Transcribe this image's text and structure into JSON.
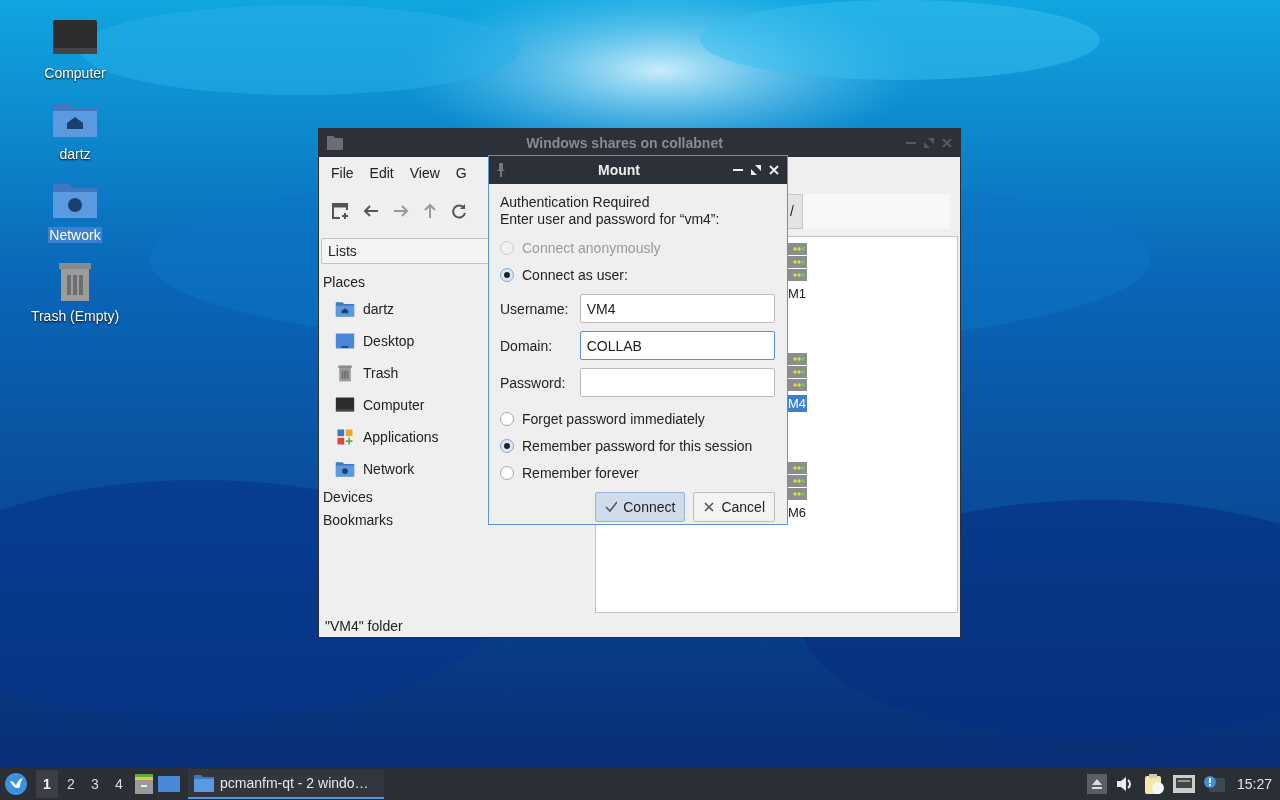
{
  "desktop_icons": [
    {
      "label": "Computer",
      "kind": "monitor",
      "selected": false
    },
    {
      "label": "dartz",
      "kind": "home-folder",
      "selected": false
    },
    {
      "label": "Network",
      "kind": "network-folder",
      "selected": true
    },
    {
      "label": "Trash (Empty)",
      "kind": "trash",
      "selected": false
    }
  ],
  "file_manager": {
    "title": "Windows shares on collabnet",
    "active": false,
    "menu": [
      "File",
      "Edit",
      "View",
      "G"
    ],
    "path_fragment": "/",
    "side_view": "Lists",
    "sidebar": [
      {
        "label": "Places",
        "children": [
          {
            "label": "dartz",
            "kind": "home-folder"
          },
          {
            "label": "Desktop",
            "kind": "desktop"
          },
          {
            "label": "Trash",
            "kind": "trash"
          },
          {
            "label": "Computer",
            "kind": "monitor"
          },
          {
            "label": "Applications",
            "kind": "apps"
          },
          {
            "label": "Network",
            "kind": "network-folder"
          }
        ]
      },
      {
        "label": "Devices"
      },
      {
        "label": "Bookmarks"
      }
    ],
    "files": [
      {
        "label": "M1",
        "selected": false
      },
      {
        "label": "M4",
        "selected": true
      },
      {
        "label": "M6",
        "selected": false
      }
    ],
    "status_bar": "\"VM4\" folder"
  },
  "mount_dialog": {
    "title": "Mount",
    "active": true,
    "heading": "Authentication Required",
    "message": "Enter user and password for “vm4”:",
    "connect_options": [
      {
        "label": "Connect anonymously",
        "selected": false,
        "disabled": true
      },
      {
        "label": "Connect as user:",
        "selected": true,
        "disabled": false
      }
    ],
    "fields": [
      {
        "label": "Username:",
        "value": "VM4",
        "focused": false
      },
      {
        "label": "Domain:",
        "value": "COLLAB",
        "focused": true
      },
      {
        "label": "Password:",
        "focused": false
      }
    ],
    "password_options": [
      {
        "label": "Forget password immediately",
        "selected": false
      },
      {
        "label": "Remember password for this session",
        "selected": true
      },
      {
        "label": "Remember forever",
        "selected": false
      }
    ],
    "buttons": [
      {
        "label": "Connect",
        "kind": "confirm",
        "default": true
      },
      {
        "label": "Cancel",
        "kind": "cancel",
        "default": false
      }
    ]
  },
  "taskbar": {
    "workspaces": [
      {
        "label": "1",
        "selected": true
      },
      {
        "label": "2",
        "selected": false
      },
      {
        "label": "3",
        "selected": false
      },
      {
        "label": "4",
        "selected": false
      }
    ],
    "tasks": [
      {
        "label": "pcmanfm-qt - 2 windo…",
        "selected": true
      }
    ],
    "clock": "15:27"
  }
}
